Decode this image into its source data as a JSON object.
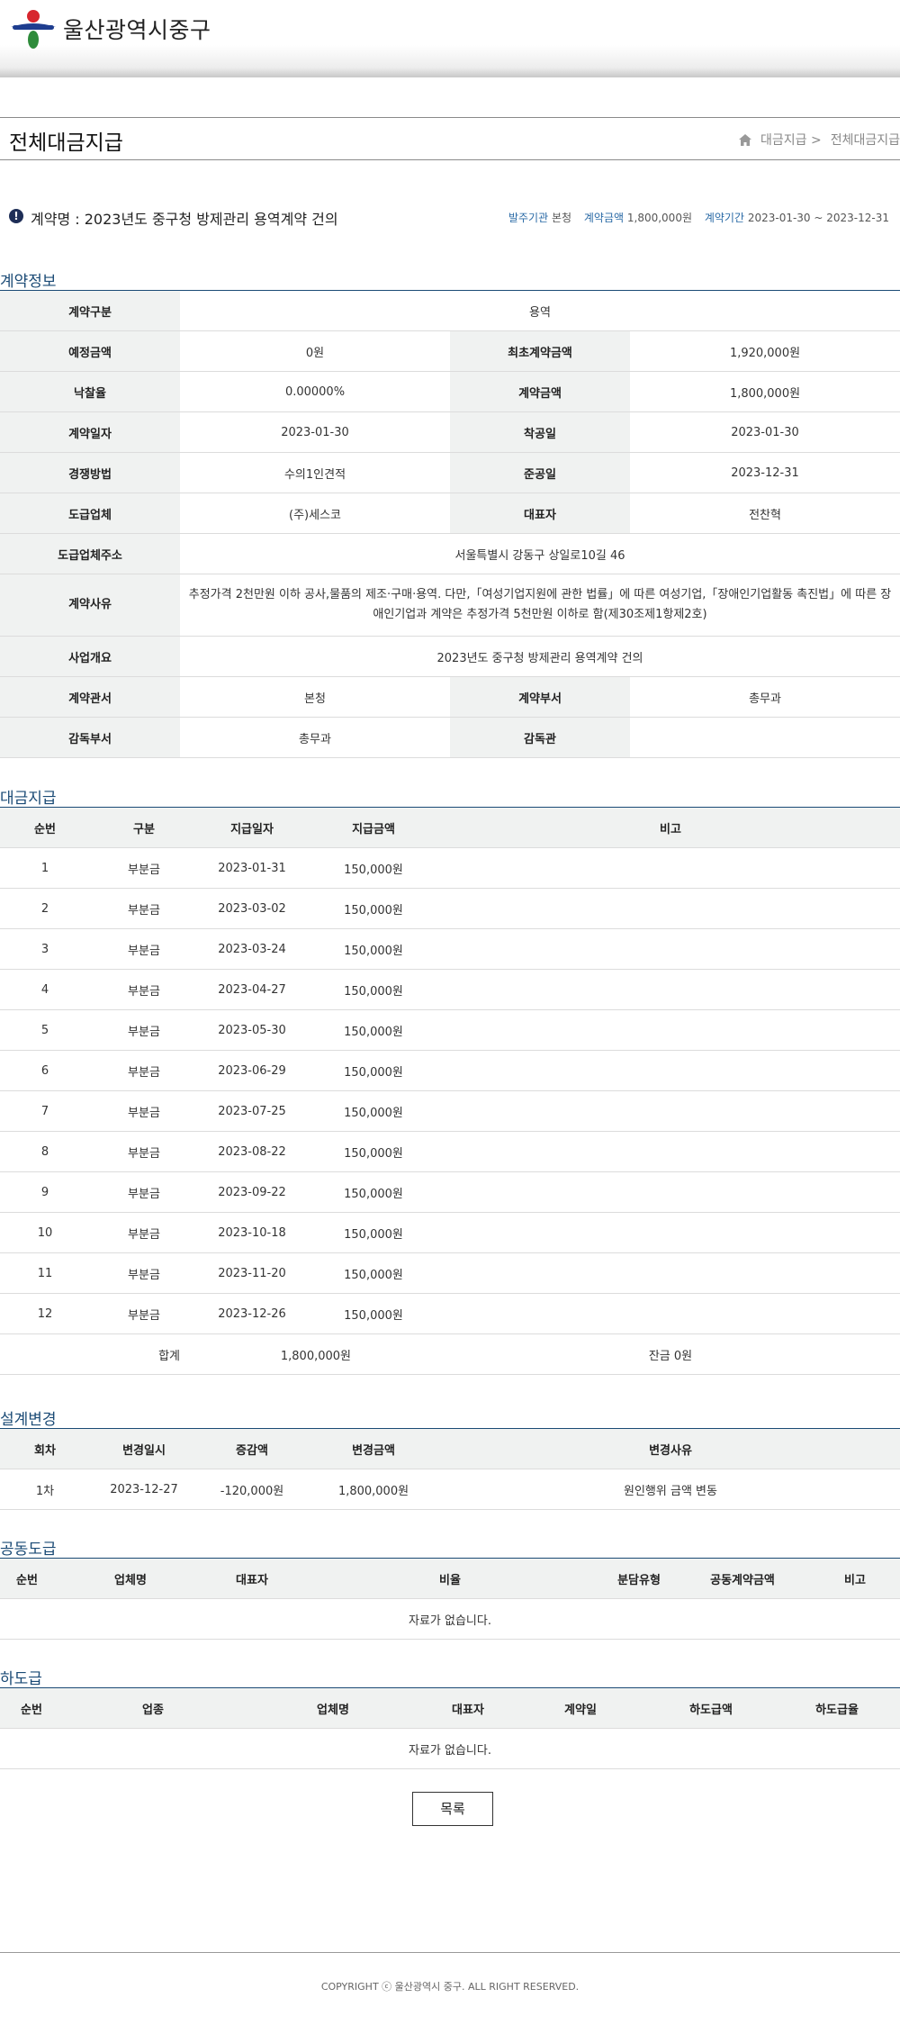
{
  "header": {
    "site_name": "울산광역시중구"
  },
  "page": {
    "title": "전체대금지급",
    "breadcrumb": [
      "대금지급 >",
      "전체대금지급"
    ]
  },
  "summary": {
    "contract_name": "계약명 : 2023년도 중구청 방제관리 용역계약 건의",
    "org_label": "발주기관",
    "org_value": "본청",
    "amount_label": "계약금액",
    "amount_value": "1,800,000원",
    "period_label": "계약기간",
    "period_value": "2023-01-30 ~ 2023-12-31"
  },
  "contract_info": {
    "section_title": "계약정보",
    "type_label": "계약구분",
    "type_value": "용역",
    "est_label": "예정금액",
    "est_value": "0원",
    "first_label": "최초계약금액",
    "first_value": "1,920,000원",
    "rate_label": "낙찰율",
    "rate_value": "0.00000%",
    "amount_label": "계약금액",
    "amount_value": "1,800,000원",
    "date_label": "계약일자",
    "date_value": "2023-01-30",
    "start_label": "착공일",
    "start_value": "2023-01-30",
    "method_label": "경쟁방법",
    "method_value": "수의1인견적",
    "end_label": "준공일",
    "end_value": "2023-12-31",
    "company_label": "도급업체",
    "company_value": "(주)세스코",
    "rep_label": "대표자",
    "rep_value": "전찬혁",
    "addr_label": "도급업체주소",
    "addr_value": "서울특별시 강동구 상일로10길 46",
    "reason_label": "계약사유",
    "reason_value": "추정가격 2천만원 이하 공사,물품의 제조·구매·용역. 다만,「여성기업지원에 관한 법률」에 따른 여성기업,「장애인기업활동 촉진법」에 따른 장애인기업과 계약은 추정가격 5천만원 이하로 함(제30조제1항제2호)",
    "overview_label": "사업개요",
    "overview_value": "2023년도 중구청 방제관리 용역계약 건의",
    "office_label": "계약관서",
    "office_value": "본청",
    "dept_label": "계약부서",
    "dept_value": "총무과",
    "sup_dept_label": "감독부서",
    "sup_dept_value": "총무과",
    "supervisor_label": "감독관",
    "supervisor_value": ""
  },
  "payments": {
    "section_title": "대금지급",
    "headers": [
      "순번",
      "구분",
      "지급일자",
      "지급금액",
      "비고"
    ],
    "rows": [
      [
        "1",
        "부분금",
        "2023-01-31",
        "150,000원",
        ""
      ],
      [
        "2",
        "부분금",
        "2023-03-02",
        "150,000원",
        ""
      ],
      [
        "3",
        "부분금",
        "2023-03-24",
        "150,000원",
        ""
      ],
      [
        "4",
        "부분금",
        "2023-04-27",
        "150,000원",
        ""
      ],
      [
        "5",
        "부분금",
        "2023-05-30",
        "150,000원",
        ""
      ],
      [
        "6",
        "부분금",
        "2023-06-29",
        "150,000원",
        ""
      ],
      [
        "7",
        "부분금",
        "2023-07-25",
        "150,000원",
        ""
      ],
      [
        "8",
        "부분금",
        "2023-08-22",
        "150,000원",
        ""
      ],
      [
        "9",
        "부분금",
        "2023-09-22",
        "150,000원",
        ""
      ],
      [
        "10",
        "부분금",
        "2023-10-18",
        "150,000원",
        ""
      ],
      [
        "11",
        "부분금",
        "2023-11-20",
        "150,000원",
        ""
      ],
      [
        "12",
        "부분금",
        "2023-12-26",
        "150,000원",
        ""
      ]
    ],
    "total_label": "합계",
    "total_value": "1,800,000원",
    "balance": "잔금 0원"
  },
  "design_change": {
    "section_title": "설계변경",
    "headers": [
      "회차",
      "변경일시",
      "증감액",
      "변경금액",
      "변경사유"
    ],
    "rows": [
      [
        "1차",
        "2023-12-27",
        "-120,000원",
        "1,800,000원",
        "원인행위 금액 변동"
      ]
    ]
  },
  "joint": {
    "section_title": "공동도급",
    "headers": [
      "순번",
      "업체명",
      "대표자",
      "비율",
      "분담유형",
      "공동계약금액",
      "비고"
    ],
    "empty": "자료가 없습니다."
  },
  "subcontract": {
    "section_title": "하도급",
    "headers": [
      "순번",
      "업종",
      "업체명",
      "대표자",
      "계약일",
      "하도급액",
      "하도급율"
    ],
    "empty": "자료가 없습니다."
  },
  "buttons": {
    "list": "목록"
  },
  "footer": {
    "copyright": "COPYRIGHT ⓒ 울산광역시 중구. ALL RIGHT RESERVED."
  }
}
